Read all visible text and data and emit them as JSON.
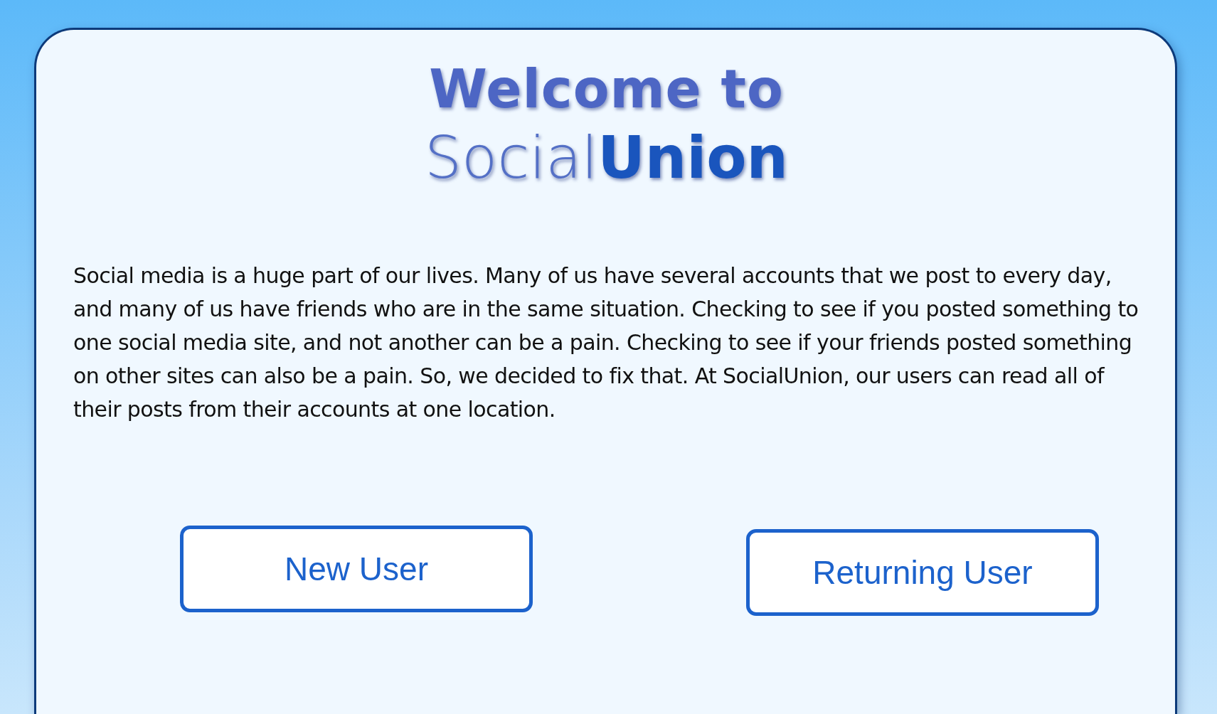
{
  "heading": "Welcome to",
  "logo": "Social**Union**",
  "description": "Social media is a huge part of our lives. Many of us have several accounts that we post to every day, and many of us have friends who are in the same situation. Checking to see if you posted something to one social media site, and not another can be a pain. Checking to see if your friends posted something on other sites can also be a pain. So, we decided to fix that. At SocialUnion, our users can read all of their posts from their accounts at one location.",
  "buttons": [
    {
      "label": "New User"
    },
    {
      "label": "Returning User"
    }
  ]
}
